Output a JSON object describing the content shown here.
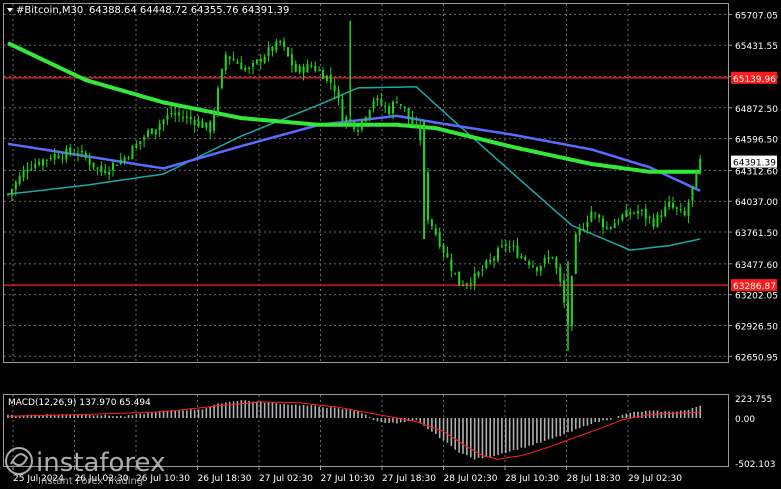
{
  "chart_header": {
    "symbol_text": "#Bitcoin,M30",
    "ohlc_text": "64388.64 64448.72 64355.76 64391.39"
  },
  "colors": {
    "background": "#000000",
    "grid": "#6b6b6b",
    "candles": "#21d321",
    "ma_fast": "#5a6cff",
    "ma_slow": "#1aa9a6",
    "ma_long": "#34e83a",
    "level_line": "#ff1a1a",
    "macd_hist": "#b0b0b0",
    "macd_signal": "#ff2020",
    "price_tag_bg": "#ffffff"
  },
  "chart_data": [
    {
      "type": "candlestick",
      "title": "#Bitcoin,M30",
      "ylim": [
        62600,
        65800
      ],
      "yticks": [
        65707.05,
        65431.55,
        65151.0,
        64872.5,
        64596.5,
        64312.6,
        64037.0,
        63761.5,
        63477.6,
        63202.05,
        62926.5,
        62650.95
      ],
      "ytick_labels": [
        "65707.05",
        "65431.55",
        "65151.00",
        "64872.50",
        "64596.50",
        "64312.60",
        "64037.00",
        "63761.50",
        "63477.60",
        "63202.05",
        "62926.50",
        "62650.95"
      ],
      "xtick_labels": [
        "25 Jul 2024",
        "26 Jul 02:30",
        "26 Jul 10:30",
        "26 Jul 18:30",
        "27 Jul 02:30",
        "27 Jul 10:30",
        "27 Jul 18:30",
        "28 Jul 02:30",
        "28 Jul 10:30",
        "28 Jul 18:30",
        "29 Jul 02:30"
      ],
      "horizontal_levels": [
        {
          "label": "65139.96",
          "value": 65139.96
        },
        {
          "label": "63286.87",
          "value": 63286.87
        }
      ],
      "current_price_label": "64391.39",
      "current_price": 64391.39,
      "close_anchors": [
        [
          0,
          64100
        ],
        [
          5,
          64350
        ],
        [
          12,
          64450
        ],
        [
          18,
          64480
        ],
        [
          24,
          64300
        ],
        [
          30,
          64430
        ],
        [
          36,
          64650
        ],
        [
          42,
          64820
        ],
        [
          48,
          64760
        ],
        [
          52,
          64680
        ],
        [
          56,
          65350
        ],
        [
          62,
          65200
        ],
        [
          66,
          65350
        ],
        [
          70,
          65450
        ],
        [
          74,
          65200
        ],
        [
          78,
          65250
        ],
        [
          82,
          65150
        ],
        [
          84,
          65050
        ],
        [
          86,
          64800
        ],
        [
          90,
          64700
        ],
        [
          94,
          64950
        ],
        [
          98,
          64850
        ],
        [
          100,
          64950
        ],
        [
          102,
          64850
        ],
        [
          106,
          64600
        ],
        [
          108,
          63900
        ],
        [
          112,
          63600
        ],
        [
          116,
          63300
        ],
        [
          120,
          63350
        ],
        [
          124,
          63500
        ],
        [
          128,
          63650
        ],
        [
          132,
          63550
        ],
        [
          136,
          63450
        ],
        [
          140,
          63550
        ],
        [
          142,
          63300
        ],
        [
          144,
          62950
        ],
        [
          146,
          63700
        ],
        [
          150,
          63950
        ],
        [
          154,
          63800
        ],
        [
          158,
          63900
        ],
        [
          162,
          63950
        ],
        [
          166,
          63850
        ],
        [
          170,
          64000
        ],
        [
          174,
          63900
        ],
        [
          176,
          64150
        ],
        [
          178,
          64390
        ]
      ],
      "series": [
        {
          "name": "ma_fast",
          "points": [
            [
              0,
              64550
            ],
            [
              20,
              64440
            ],
            [
              40,
              64330
            ],
            [
              60,
              64530
            ],
            [
              80,
              64720
            ],
            [
              100,
              64800
            ],
            [
              110,
              64740
            ],
            [
              130,
              64630
            ],
            [
              150,
              64500
            ],
            [
              165,
              64340
            ],
            [
              178,
              64130
            ]
          ]
        },
        {
          "name": "ma_slow",
          "points": [
            [
              0,
              64100
            ],
            [
              20,
              64180
            ],
            [
              40,
              64280
            ],
            [
              60,
              64620
            ],
            [
              80,
              64900
            ],
            [
              90,
              65050
            ],
            [
              105,
              65060
            ],
            [
              110,
              64900
            ],
            [
              130,
              64280
            ],
            [
              145,
              63820
            ],
            [
              160,
              63600
            ],
            [
              170,
              63640
            ],
            [
              178,
              63700
            ]
          ]
        },
        {
          "name": "ma_long",
          "points": [
            [
              0,
              65450
            ],
            [
              20,
              65120
            ],
            [
              40,
              64920
            ],
            [
              60,
              64780
            ],
            [
              80,
              64720
            ],
            [
              100,
              64720
            ],
            [
              110,
              64690
            ],
            [
              130,
              64520
            ],
            [
              150,
              64370
            ],
            [
              165,
              64300
            ],
            [
              178,
              64300
            ]
          ]
        }
      ]
    },
    {
      "type": "bar",
      "title": "MACD(12,26,9) 137.970 65.494",
      "ylim": [
        -502.103,
        223.755
      ],
      "ytick_labels": [
        "223.755",
        "0.00",
        "-502.103"
      ],
      "hist_anchors": [
        [
          0,
          30
        ],
        [
          10,
          40
        ],
        [
          20,
          40
        ],
        [
          30,
          20
        ],
        [
          40,
          80
        ],
        [
          50,
          100
        ],
        [
          55,
          170
        ],
        [
          60,
          200
        ],
        [
          70,
          160
        ],
        [
          80,
          130
        ],
        [
          90,
          80
        ],
        [
          95,
          -40
        ],
        [
          100,
          -60
        ],
        [
          105,
          -30
        ],
        [
          108,
          -120
        ],
        [
          112,
          -250
        ],
        [
          116,
          -380
        ],
        [
          120,
          -460
        ],
        [
          125,
          -420
        ],
        [
          130,
          -360
        ],
        [
          135,
          -300
        ],
        [
          140,
          -230
        ],
        [
          145,
          -150
        ],
        [
          150,
          -60
        ],
        [
          155,
          -10
        ],
        [
          160,
          60
        ],
        [
          165,
          80
        ],
        [
          170,
          70
        ],
        [
          175,
          90
        ],
        [
          178,
          140
        ]
      ],
      "signal_anchors": [
        [
          0,
          20
        ],
        [
          20,
          40
        ],
        [
          40,
          70
        ],
        [
          55,
          140
        ],
        [
          65,
          180
        ],
        [
          75,
          170
        ],
        [
          85,
          120
        ],
        [
          95,
          40
        ],
        [
          105,
          -40
        ],
        [
          112,
          -150
        ],
        [
          118,
          -320
        ],
        [
          122,
          -420
        ],
        [
          126,
          -460
        ],
        [
          132,
          -420
        ],
        [
          138,
          -340
        ],
        [
          145,
          -230
        ],
        [
          152,
          -120
        ],
        [
          158,
          -20
        ],
        [
          165,
          40
        ],
        [
          172,
          55
        ],
        [
          178,
          65
        ]
      ]
    }
  ],
  "branding": {
    "logo_text": "instaforex",
    "tagline_text": "Instant Forex Trading"
  }
}
